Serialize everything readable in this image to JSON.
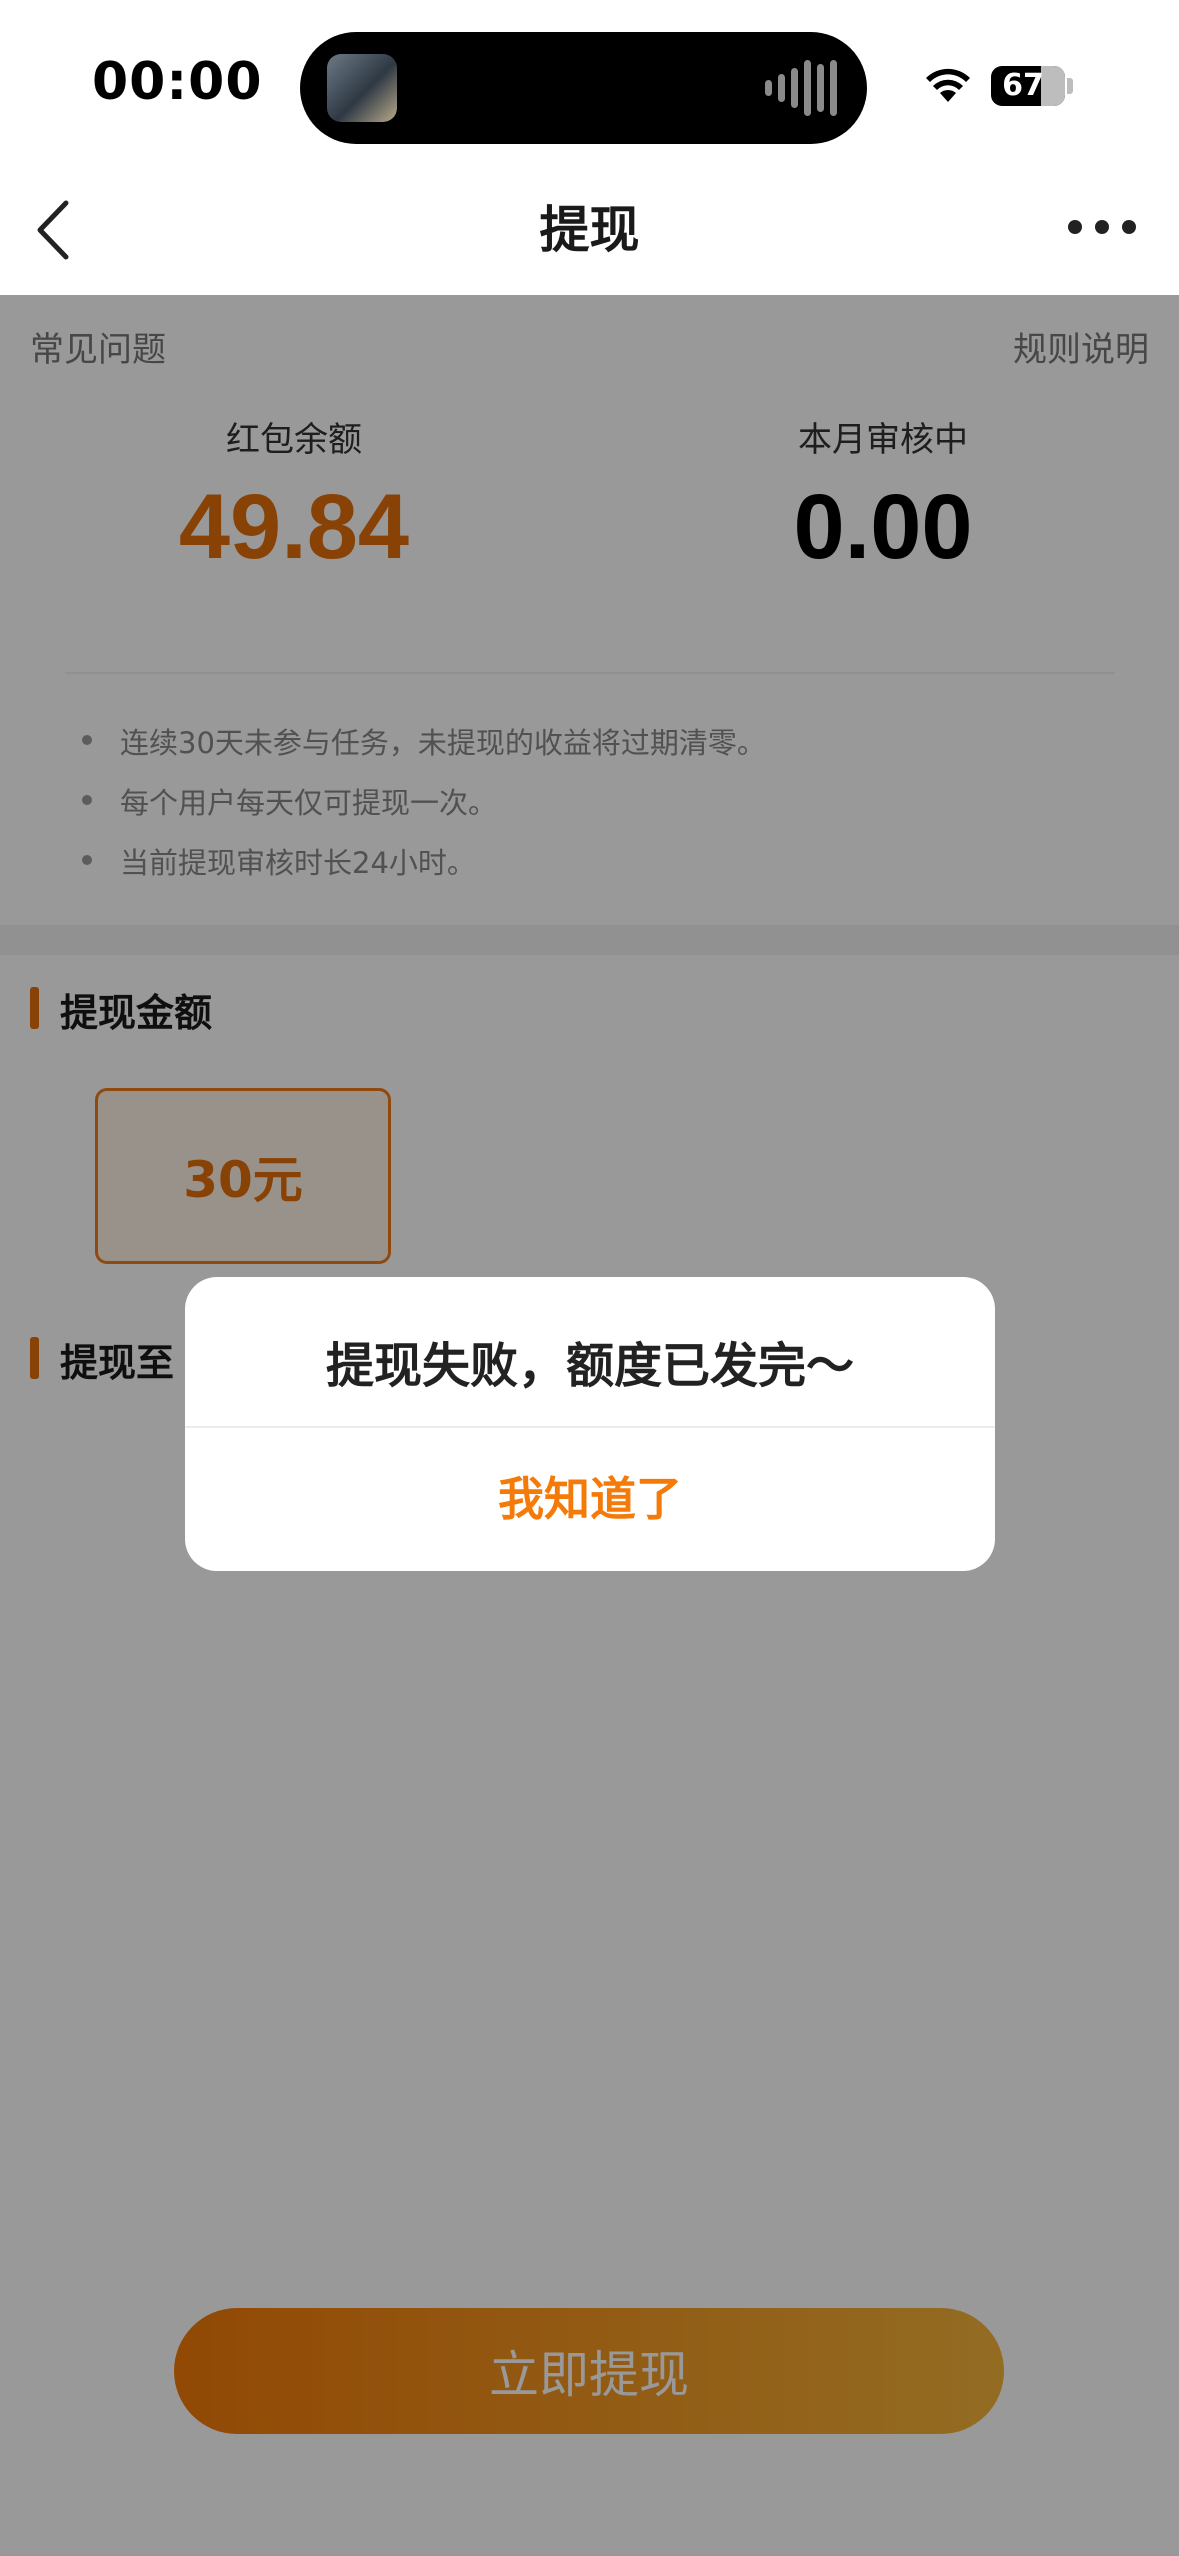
{
  "status_bar": {
    "time": "00:00",
    "battery": "67"
  },
  "nav": {
    "title": "提现",
    "back_icon": "chevron-left-icon",
    "more_icon": "ellipsis-icon"
  },
  "links": {
    "faq": "常见问题",
    "rules": "规则说明"
  },
  "stats": {
    "balance_label": "红包余额",
    "balance_value": "49.84",
    "review_label": "本月审核中",
    "review_value": "0.00"
  },
  "rules": [
    "连续30天未参与任务，未提现的收益将过期清零。",
    "每个用户每天仅可提现一次。",
    "当前提现审核时长24小时。"
  ],
  "withdraw_amount": {
    "title": "提现金额",
    "option": "30元"
  },
  "withdraw_to": {
    "title": "提现至"
  },
  "cta": {
    "label": "立即提现"
  },
  "dialog": {
    "message": "提现失败，额度已发完～",
    "confirm": "我知道了"
  },
  "colors": {
    "accent": "#F47B0A",
    "amount": "#E36F0A",
    "overlay": "rgba(0,0,0,0.40)"
  }
}
